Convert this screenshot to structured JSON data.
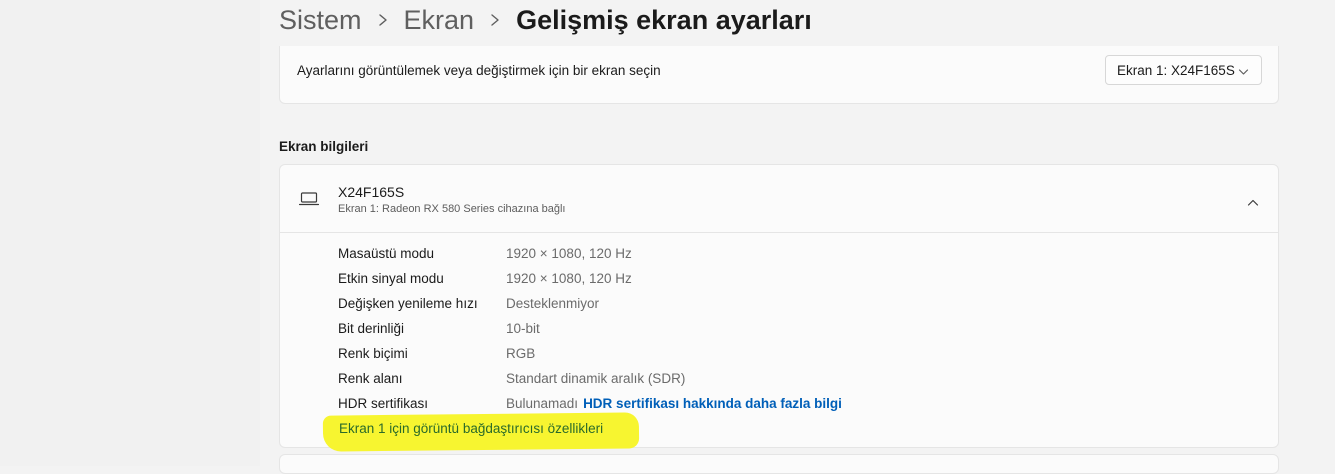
{
  "breadcrumb": {
    "items": [
      "Sistem",
      "Ekran"
    ],
    "current": "Gelişmiş ekran ayarları"
  },
  "display_select": {
    "label": "Ayarlarını görüntülemek veya değiştirmek için bir ekran seçin",
    "selected": "Ekran 1: X24F165S"
  },
  "section": {
    "title": "Ekran bilgileri"
  },
  "monitor": {
    "name": "X24F165S",
    "subtitle": "Ekran 1: Radeon RX 580 Series cihazına bağlı"
  },
  "properties": [
    {
      "label": "Masaüstü modu",
      "value": "1920 × 1080, 120 Hz"
    },
    {
      "label": "Etkin sinyal modu",
      "value": "1920 × 1080, 120 Hz"
    },
    {
      "label": "Değişken yenileme hızı",
      "value": "Desteklenmiyor"
    },
    {
      "label": "Bit derinliği",
      "value": "10-bit"
    },
    {
      "label": "Renk biçimi",
      "value": "RGB"
    },
    {
      "label": "Renk alanı",
      "value": "Standart dinamik aralık (SDR)"
    },
    {
      "label": "HDR sertifikası",
      "value": "Bulunamadı",
      "link": "HDR sertifikası hakkında daha fazla bilgi"
    }
  ],
  "adapter_link": "Ekran 1 için görüntü bağdaştırıcısı özellikleri",
  "icons": {
    "breadcrumb_separator": "chevron-right-icon",
    "dropdown": "chevron-down-icon",
    "monitor": "laptop-icon",
    "collapse": "chevron-up-icon"
  },
  "colors": {
    "accent_link": "#005fb8",
    "highlight": "#f7f530",
    "background": "#f3f3f3",
    "card": "#fbfbfb"
  }
}
